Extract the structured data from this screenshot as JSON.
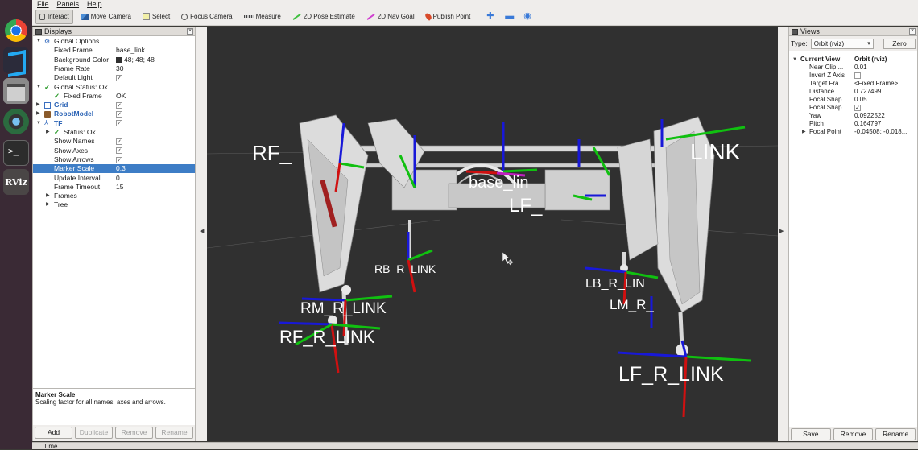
{
  "menu": {
    "file": "File",
    "panels": "Panels",
    "help": "Help"
  },
  "toolbar": {
    "interact": "Interact",
    "move_camera": "Move Camera",
    "select": "Select",
    "focus_camera": "Focus Camera",
    "measure": "Measure",
    "pose_estimate": "2D Pose Estimate",
    "nav_goal": "2D Nav Goal",
    "publish_point": "Publish Point"
  },
  "displays": {
    "title": "Displays",
    "rows": [
      {
        "name": "Global Options",
        "value": ""
      },
      {
        "name": "Fixed Frame",
        "value": "base_link"
      },
      {
        "name": "Background Color",
        "value": "48; 48; 48"
      },
      {
        "name": "Frame Rate",
        "value": "30"
      },
      {
        "name": "Default Light",
        "value": ""
      },
      {
        "name": "Global Status: Ok",
        "value": ""
      },
      {
        "name": "Fixed Frame",
        "value": "OK"
      },
      {
        "name": "Grid",
        "value": ""
      },
      {
        "name": "RobotModel",
        "value": ""
      },
      {
        "name": "TF",
        "value": ""
      },
      {
        "name": "Status: Ok",
        "value": ""
      },
      {
        "name": "Show Names",
        "value": ""
      },
      {
        "name": "Show Axes",
        "value": ""
      },
      {
        "name": "Show Arrows",
        "value": ""
      },
      {
        "name": "Marker Scale",
        "value": "0.3"
      },
      {
        "name": "Update Interval",
        "value": "0"
      },
      {
        "name": "Frame Timeout",
        "value": "15"
      },
      {
        "name": "Frames",
        "value": ""
      },
      {
        "name": "Tree",
        "value": ""
      }
    ],
    "description_title": "Marker Scale",
    "description_text": "Scaling factor for all names, axes and arrows.",
    "buttons": {
      "add": "Add",
      "duplicate": "Duplicate",
      "remove": "Remove",
      "rename": "Rename"
    }
  },
  "viewport": {
    "labels": {
      "rf_top": "RF_",
      "lf_top": "LINK",
      "rb": "RB_R_LINK",
      "rm": "RM_R_LINK",
      "rf": "RF_R_LINK",
      "lb": "LB_R_LIN",
      "lm": "LM_R_",
      "lf": "LF_R_LINK",
      "base": "base_lin",
      "lf_mid": "LF_"
    }
  },
  "views": {
    "title": "Views",
    "type_label": "Type:",
    "type_value": "Orbit (rviz)",
    "zero": "Zero",
    "current_view": "Current View",
    "current_view_value": "Orbit (rviz)",
    "rows": [
      {
        "name": "Near Clip ...",
        "value": "0.01"
      },
      {
        "name": "Invert Z Axis",
        "value": ""
      },
      {
        "name": "Target Fra...",
        "value": "<Fixed Frame>"
      },
      {
        "name": "Distance",
        "value": "0.727499"
      },
      {
        "name": "Focal Shap...",
        "value": "0.05"
      },
      {
        "name": "Focal Shap...",
        "value": ""
      },
      {
        "name": "Yaw",
        "value": "0.0922522"
      },
      {
        "name": "Pitch",
        "value": "0.164797"
      },
      {
        "name": "Focal Point",
        "value": "-0.04508; -0.018..."
      }
    ],
    "buttons": {
      "save": "Save",
      "remove": "Remove",
      "rename": "Rename"
    }
  },
  "timebar": {
    "label": "Time"
  },
  "colors": {
    "background": "#303030",
    "selection": "#3d7dc6",
    "x_axis": "#e01010",
    "y_axis": "#10d010",
    "z_axis": "#1010e0"
  },
  "icons": [
    "chrome-icon",
    "vscode-icon",
    "files-icon",
    "globe-icon",
    "terminal-icon",
    "rviz-icon"
  ]
}
